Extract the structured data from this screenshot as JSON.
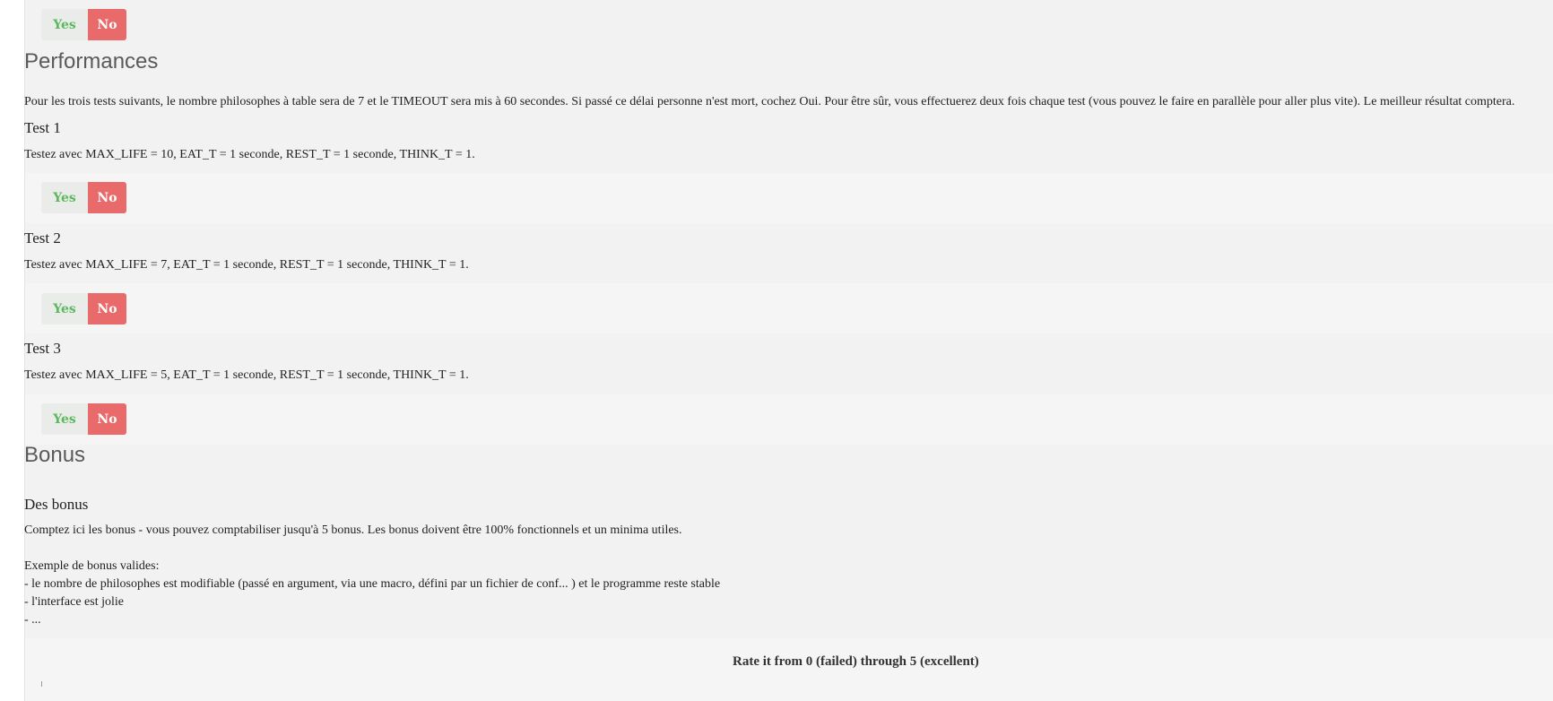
{
  "top_toggle": {
    "yes": "Yes",
    "no": "No"
  },
  "performances": {
    "title": "Performances",
    "intro": "Pour les trois tests suivants, le nombre philosophes à table sera de 7 et le TIMEOUT sera mis à 60 secondes. Si passé ce délai personne n'est mort, cochez Oui. Pour être sûr, vous effectuerez deux fois chaque test (vous pouvez le faire en parallèle pour aller plus vite). Le meilleur résultat comptera.",
    "tests": [
      {
        "title": "Test 1",
        "desc": "Testez avec MAX_LIFE = 10, EAT_T = 1 seconde, REST_T = 1 seconde, THINK_T = 1.",
        "yes": "Yes",
        "no": "No"
      },
      {
        "title": "Test 2",
        "desc": "Testez avec MAX_LIFE = 7, EAT_T = 1 seconde, REST_T = 1 seconde, THINK_T = 1.",
        "yes": "Yes",
        "no": "No"
      },
      {
        "title": "Test 3",
        "desc": "Testez avec MAX_LIFE = 5, EAT_T = 1 seconde, REST_T = 1 seconde, THINK_T = 1.",
        "yes": "Yes",
        "no": "No"
      }
    ]
  },
  "bonus": {
    "title": "Bonus",
    "subtitle": "Des bonus",
    "lines": [
      "Comptez ici les bonus - vous pouvez comptabiliser jusqu'à 5 bonus. Les bonus doivent être 100% fonctionnels et un minima utiles.",
      "Exemple de bonus valides:",
      "- le nombre de philosophes est modifiable (passé en argument, via une macro, défini par un fichier de conf... ) et le programme reste stable",
      "- l'interface est jolie",
      "- ..."
    ],
    "rate_label": "Rate it from 0 (failed) through 5 (excellent)"
  },
  "colors": {
    "yes_text": "#5cb85c",
    "no_bg": "#e96a6a",
    "section_title": "#5a5a5a"
  }
}
